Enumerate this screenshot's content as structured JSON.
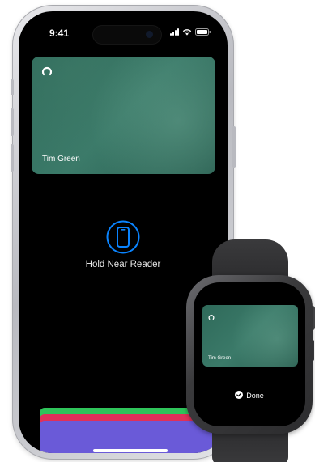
{
  "phone": {
    "status_time": "9:41",
    "card": {
      "cardholder_name": "Tim Green"
    },
    "hold_near_reader_label": "Hold Near Reader",
    "card_stack_colors": [
      "#2fc45a",
      "#e0305a",
      "#6a5ad8"
    ]
  },
  "watch": {
    "card": {
      "cardholder_name": "Tim Green"
    },
    "done_label": "Done"
  },
  "colors": {
    "card_green": "#3b7a69",
    "accent_blue": "#0a84ff"
  },
  "icons": [
    "card-logo-icon",
    "phone-reader-icon",
    "checkmark-icon",
    "signal-icon",
    "wifi-icon",
    "battery-icon"
  ]
}
